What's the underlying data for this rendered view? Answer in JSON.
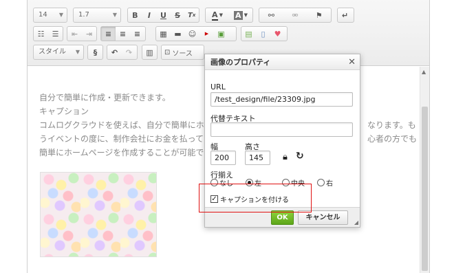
{
  "toolbar": {
    "font_size": "14",
    "line_height": "1.7",
    "style_select": "スタイル",
    "source_label": "ソース",
    "row1": [
      "B",
      "I",
      "U",
      "S",
      "Tx",
      "A",
      "A",
      "link",
      "unlink",
      "flag",
      "enter"
    ],
    "row2": [
      "numbered-list",
      "bullet-list",
      "outdent",
      "indent",
      "align-left",
      "align-center",
      "align-right",
      "table",
      "horizontal-rule",
      "smiley",
      "youtube",
      "image",
      "template",
      "document",
      "heart"
    ],
    "row3": [
      "code",
      "undo",
      "redo",
      "paste",
      "source"
    ]
  },
  "content": {
    "line1": "自分で簡単に作成・更新できます。",
    "line2": "キャプション",
    "line3": "コムログクラウドを使えば、自分で簡単にホー",
    "line3_right": "なります。も",
    "line4": "うイベントの度に、制作会社にお金を払って",
    "line4_right": "心者の方でも",
    "line5": "簡単にホームページを作成することが可能です"
  },
  "dialog": {
    "title": "画像のプロパティ",
    "close_icon": "✕",
    "url_label": "URL",
    "url_value": "/test_design/file/23309.jpg",
    "alt_label": "代替テキスト",
    "alt_value": "",
    "width_label": "幅",
    "width_value": "200",
    "height_label": "高さ",
    "height_value": "145",
    "align_label": "行揃え",
    "align_options": [
      "なし",
      "左",
      "中央",
      "右"
    ],
    "align_selected": "左",
    "caption_label": "キャプションを付ける",
    "caption_checked": true,
    "ok_label": "OK",
    "cancel_label": "キャンセル"
  },
  "colors": {
    "highlight": "#e01010",
    "ok_button": "#6cb622",
    "text_muted": "#8a8a8a"
  }
}
